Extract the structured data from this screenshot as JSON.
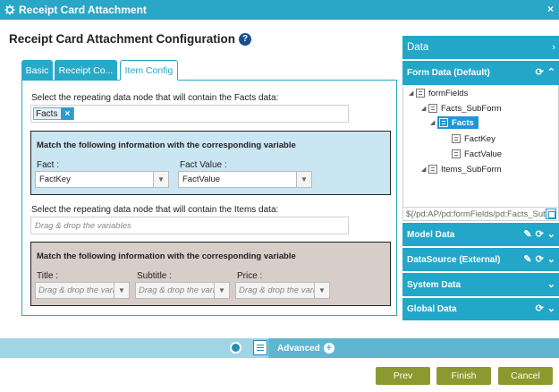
{
  "window": {
    "title": "Receipt Card Attachment",
    "close_glyph": "×"
  },
  "heading": {
    "title": "Receipt Card Attachment Configuration",
    "help_glyph": "?"
  },
  "tabs": [
    {
      "label": "Basic",
      "active": false
    },
    {
      "label": "Receipt Co...",
      "active": false
    },
    {
      "label": "Item Config",
      "active": true
    }
  ],
  "facts_section": {
    "label": "Select the repeating data node that will contain the Facts data:",
    "tag_value": "Facts",
    "tag_remove_glyph": "×"
  },
  "facts_mapping": {
    "heading": "Match the following information with the corresponding variable",
    "fact_label": "Fact :",
    "fact_value": "FactKey",
    "fact_value_label": "Fact Value :",
    "fact_value_value": "FactValue"
  },
  "items_section": {
    "label": "Select the repeating data node that will contain the Items data:",
    "placeholder": "Drag & drop the variables"
  },
  "items_mapping": {
    "heading": "Match the following information with the corresponding variable",
    "title_label": "Title :",
    "subtitle_label": "Subtitle :",
    "price_label": "Price :",
    "select_placeholder": "Drag & drop the variables"
  },
  "sidebar": {
    "header": "Data",
    "form_data": "Form Data (Default)",
    "tree": [
      {
        "label": "formFields"
      },
      {
        "label": "Facts_SubForm"
      },
      {
        "label": "Facts"
      },
      {
        "label": "FactKey"
      },
      {
        "label": "FactValue"
      },
      {
        "label": "Items_SubForm"
      }
    ],
    "path_value": "${/pd:AP/pd:formFields/pd:Facts_SubForm/pd:Facts}",
    "sections": [
      {
        "label": "Model Data"
      },
      {
        "label": "DataSource (External)"
      },
      {
        "label": "System Data"
      },
      {
        "label": "Global Data"
      }
    ]
  },
  "footer": {
    "advanced_label": "Advanced",
    "prev_label": "Prev",
    "finish_label": "Finish",
    "cancel_label": "Cancel"
  }
}
